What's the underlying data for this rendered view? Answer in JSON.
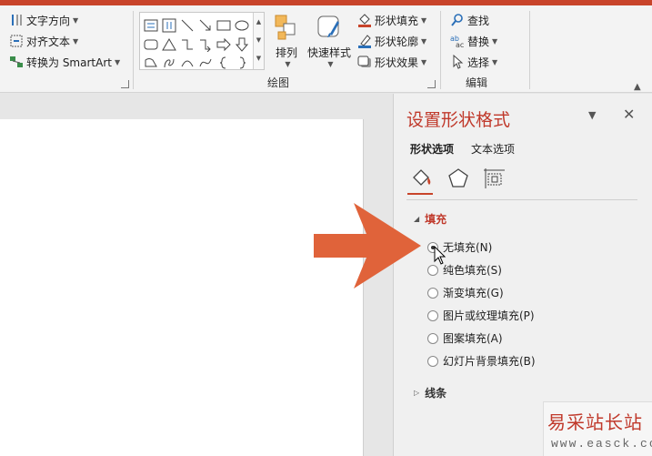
{
  "ribbon": {
    "text_group": {
      "text_direction": "文字方向",
      "align_text": "对齐文本",
      "convert_smartart": "转换为 SmartArt"
    },
    "drawing_group": {
      "label": "绘图",
      "arrange": "排列",
      "quick_styles": "快速样式",
      "shape_fill": "形状填充",
      "shape_outline": "形状轮廓",
      "shape_effects": "形状效果"
    },
    "editing_group": {
      "label": "编辑",
      "find": "查找",
      "replace": "替换",
      "select": "选择"
    }
  },
  "pane": {
    "title": "设置形状格式",
    "tabs": [
      "形状选项",
      "文本选项"
    ],
    "active_tab": "形状选项",
    "icons": [
      "fill-line-icon",
      "effects-pentagon-icon",
      "size-properties-icon"
    ],
    "fill_section": {
      "label": "填充",
      "expanded": true,
      "options": [
        {
          "label": "无填充(N)",
          "checked": true
        },
        {
          "label": "纯色填充(S)",
          "checked": false
        },
        {
          "label": "渐变填充(G)",
          "checked": false
        },
        {
          "label": "图片或纹理填充(P)",
          "checked": false
        },
        {
          "label": "图案填充(A)",
          "checked": false
        },
        {
          "label": "幻灯片背景填充(B)",
          "checked": false
        }
      ]
    },
    "line_section": {
      "label": "线条",
      "expanded": false
    }
  },
  "watermark": {
    "title": "易采站长站",
    "url": "www.easck.com"
  },
  "colors": {
    "accent": "#c8442a",
    "arrow": "#e0633a",
    "pane_title": "#c0392b"
  }
}
